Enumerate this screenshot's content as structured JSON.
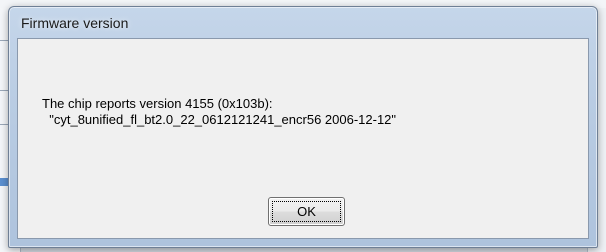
{
  "dialog": {
    "title": "Firmware version",
    "message_line1": "The chip reports version 4155 (0x103b):",
    "message_line2": "\"cyt_8unified_fl_bt2.0_22_0612121241_encr56 2006-12-12\"",
    "ok_label": "OK"
  }
}
